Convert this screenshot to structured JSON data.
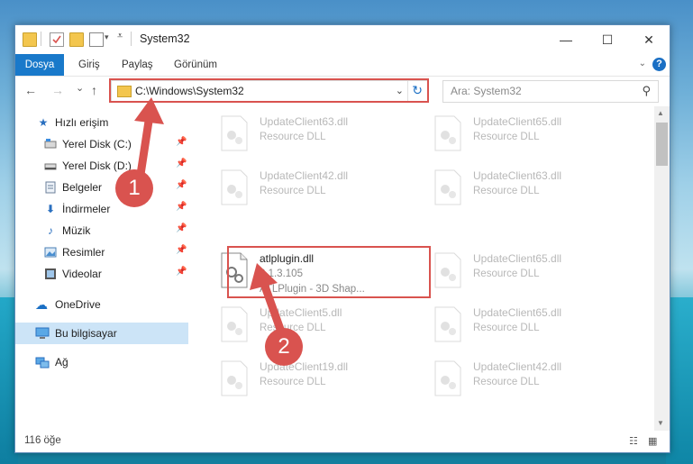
{
  "window": {
    "title": "System32",
    "minimize": "—",
    "maximize": "☐",
    "close": "✕"
  },
  "ribbon": {
    "tabs": [
      {
        "label": "Dosya",
        "active": true
      },
      {
        "label": "Giriş"
      },
      {
        "label": "Paylaş"
      },
      {
        "label": "Görünüm"
      }
    ],
    "help": "?"
  },
  "nav": {
    "back": "←",
    "forward": "→",
    "recent": "⌄",
    "up": "↑",
    "address": "C:\\Windows\\System32",
    "search_placeholder": "Ara: System32"
  },
  "sidebar": {
    "items": [
      {
        "label": "Hızlı erişim",
        "icon": "star-icon"
      },
      {
        "label": "Yerel Disk (C:)",
        "icon": "drive-icon",
        "pinned": true
      },
      {
        "label": "Yerel Disk (D:)",
        "icon": "drive-icon",
        "pinned": true
      },
      {
        "label": "Belgeler",
        "icon": "documents-icon",
        "pinned": true
      },
      {
        "label": "İndirmeler",
        "icon": "download-icon",
        "pinned": true
      },
      {
        "label": "Müzik",
        "icon": "music-icon",
        "pinned": true
      },
      {
        "label": "Resimler",
        "icon": "pictures-icon",
        "pinned": true
      },
      {
        "label": "Videolar",
        "icon": "videos-icon",
        "pinned": true
      },
      {
        "label": "OneDrive",
        "icon": "cloud-icon"
      },
      {
        "label": "Bu bilgisayar",
        "icon": "computer-icon",
        "selected": true
      },
      {
        "label": "Ağ",
        "icon": "network-icon"
      }
    ]
  },
  "files": {
    "left": [
      {
        "name": "UpdateClient63.dll",
        "desc": "Resource DLL"
      },
      {
        "name": "UpdateClient42.dll",
        "desc": "Resource DLL"
      },
      {
        "name": "atlplugin.dll",
        "version": "2.1.3.105",
        "desc": "ATLPlugin - 3D Shap...",
        "highlighted": true
      },
      {
        "name": "UpdateClient5.dll",
        "desc": "Resource DLL"
      },
      {
        "name": "UpdateClient19.dll",
        "desc": "Resource DLL"
      }
    ],
    "right": [
      {
        "name": "UpdateClient65.dll",
        "desc": "Resource DLL"
      },
      {
        "name": "UpdateClient63.dll",
        "desc": "Resource DLL"
      },
      {
        "name": "UpdateClient65.dll",
        "desc": "Resource DLL"
      },
      {
        "name": "UpdateClient65.dll",
        "desc": "Resource DLL"
      },
      {
        "name": "UpdateClient42.dll",
        "desc": "Resource DLL"
      }
    ]
  },
  "status": {
    "count": "116 öğe"
  },
  "annotations": {
    "step1": "1",
    "step2": "2",
    "color": "#d9534f"
  }
}
